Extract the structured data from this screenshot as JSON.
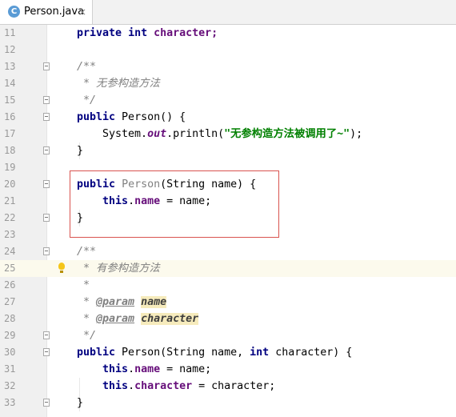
{
  "tab": {
    "icon_letter": "C",
    "filename": "Person.java",
    "close_glyph": "×"
  },
  "icons": [
    "java-class-icon",
    "close-icon",
    "fold-icon",
    "intention-bulb-icon"
  ],
  "colors": {
    "keyword": "#000080",
    "comment": "#808080",
    "field": "#660e7a",
    "string": "#008000",
    "highlight_box": "#d9534f",
    "current_line": "#fcfaed"
  },
  "lines": {
    "l11": {
      "num": "11",
      "t1": "private",
      "t2": " ",
      "t3": "int",
      "t4": " character;"
    },
    "l12": {
      "num": "12"
    },
    "l13": {
      "num": "13",
      "t1": "/**"
    },
    "l14": {
      "num": "14",
      "t1": " * 无参构造方法"
    },
    "l15": {
      "num": "15",
      "t1": " */"
    },
    "l16": {
      "num": "16",
      "t1": "public",
      "t2": " Person() {"
    },
    "l17": {
      "num": "17",
      "t1": "    System.",
      "t2": "out",
      "t3": ".println(",
      "t4": "\"无参构造方法被调用了~\"",
      "t5": ");"
    },
    "l18": {
      "num": "18",
      "t1": "}"
    },
    "l19": {
      "num": "19"
    },
    "l20": {
      "num": "20",
      "t1": "public",
      "t2": " ",
      "t3": "Person",
      "t4": "(String name) {"
    },
    "l21": {
      "num": "21",
      "t1": "    ",
      "t2": "this",
      "t3": ".",
      "t4": "name",
      "t5": " = name;"
    },
    "l22": {
      "num": "22",
      "t1": "}"
    },
    "l23": {
      "num": "23"
    },
    "l24": {
      "num": "24",
      "t1": "/**"
    },
    "l25": {
      "num": "25",
      "t1": " * 有参构造方法"
    },
    "l26": {
      "num": "26",
      "t1": " *"
    },
    "l27": {
      "num": "27",
      "t1": " * ",
      "t2": "@param",
      "t3": " ",
      "t4": "name"
    },
    "l28": {
      "num": "28",
      "t1": " * ",
      "t2": "@param",
      "t3": " ",
      "t4": "character"
    },
    "l29": {
      "num": "29",
      "t1": " */"
    },
    "l30": {
      "num": "30",
      "t1": "public",
      "t2": " Person(String name, ",
      "t3": "int",
      "t4": " character) {"
    },
    "l31": {
      "num": "31",
      "t1": "    ",
      "t2": "this",
      "t3": ".",
      "t4": "name",
      "t5": " = name;"
    },
    "l32": {
      "num": "32",
      "t1": "    ",
      "t2": "this",
      "t3": ".",
      "t4": "character",
      "t5": " = character;"
    },
    "l33": {
      "num": "33",
      "t1": "}"
    }
  }
}
